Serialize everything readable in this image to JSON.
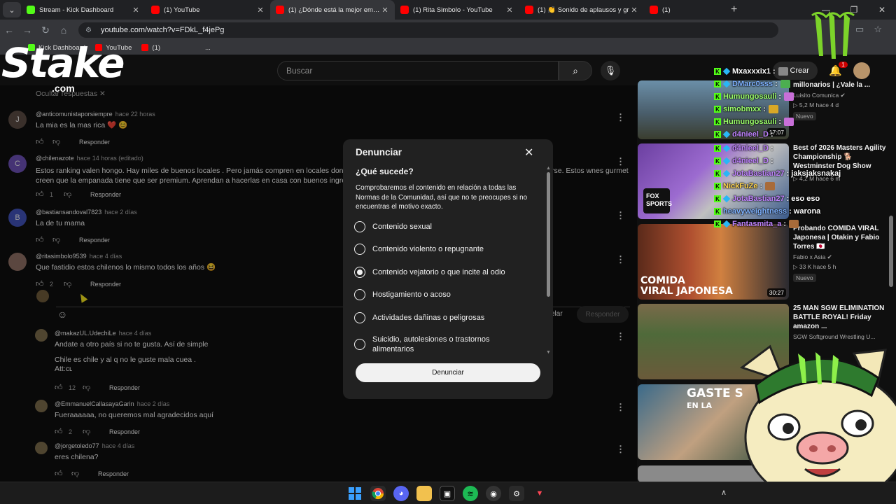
{
  "browser": {
    "tabs": [
      {
        "label": "Stream - Kick Dashboard",
        "icon": "kick-icon",
        "active": false
      },
      {
        "label": "(1) YouTube",
        "icon": "youtube-icon",
        "active": false
      },
      {
        "label": "(1) ¿Dónde está la mejor empan",
        "icon": "youtube-icon",
        "active": true
      },
      {
        "label": "(1) Rita Simbolo - YouTube",
        "icon": "youtube-icon",
        "active": false
      },
      {
        "label": "(1) 👏 Sonido de aplausos y gr",
        "icon": "youtube-icon",
        "active": false
      },
      {
        "label": "(1)",
        "icon": "youtube-icon",
        "active": false
      }
    ],
    "url": "youtube.com/watch?v=FDkL_f4jePg",
    "bookmarks": [
      "Kick Dashboard",
      "YouTube",
      "(1)",
      "..."
    ]
  },
  "header": {
    "search_placeholder": "Buscar",
    "create_label": "Crear",
    "notif_count": "1"
  },
  "overlay": {
    "stake_word": "Stake",
    "stake_com": ".com",
    "hide_replies": "Ocultar respuestas"
  },
  "comments": [
    {
      "author": "@anticomunistaporsiempre",
      "time": "hace 22 horas",
      "text": "La mia es la mas rica ❤️ 😊",
      "likes": "",
      "reply": "Responder",
      "avatar": "J",
      "avatar_color": "#5a4a42"
    },
    {
      "author": "@chilenazote",
      "time": "hace 14 horas (editado)",
      "text1": "Estos ranking valen hongo. Hay miles de buenos locales . Pero jamás compren en locales dond",
      "text1b": "rse. Estos wnes gurmet",
      "text2": "creen que la empanada tiene que ser premium. Aprendan a hacerlas en  casa con buenos ingre",
      "likes": "1",
      "reply": "Responder",
      "avatar": "C",
      "avatar_color": "#6a4fb3"
    },
    {
      "author": "@bastiansandoval7823",
      "time": "hace 2 días",
      "text": "La de tu mama",
      "likes": "",
      "reply": "Responder",
      "avatar": "B",
      "avatar_color": "#3f51b5"
    },
    {
      "author": "@ritasimbolo9539",
      "time": "hace 4 días",
      "text": "Que fastidio estos chilenos lo mismo todos los años 😆",
      "likes": "2",
      "reply": "Responder",
      "avatar": "",
      "avatar_color": "#8d6e63"
    }
  ],
  "reply_box": {
    "cancel": "elar",
    "submit": "Responder"
  },
  "replies": [
    {
      "author": "@makazUL.UdechiLe",
      "time": "hace 4 días",
      "line1": "Andate a otro país si no te gusta. Así de simple",
      "line2": "Chile es chile y al q no le guste mala cuea .",
      "line3": "Att:cʟ",
      "likes": "12",
      "reply": "Responder"
    },
    {
      "author": "@EmmanuelCallasayaGarin",
      "time": "hace 2 días",
      "line1": "Fueraaaaaa, no queremos mal agradecidos aquí",
      "likes": "2",
      "reply": "Responder"
    },
    {
      "author": "@jorgetoledo77",
      "time": "hace 4 días",
      "line1": "eres chilena?",
      "likes": "",
      "reply": "Responder"
    }
  ],
  "modal": {
    "title": "Denunciar",
    "question": "¿Qué sucede?",
    "description": "Comprobaremos el contenido en relación a todas las Normas de la Comunidad, así que no te preocupes si no encuentras el motivo exacto.",
    "options": [
      {
        "label": "Contenido sexual",
        "selected": false
      },
      {
        "label": "Contenido violento o repugnante",
        "selected": false
      },
      {
        "label": "Contenido vejatorio o que incite al odio",
        "selected": true
      },
      {
        "label": "Hostigamiento o acoso",
        "selected": false
      },
      {
        "label": "Actividades dañinas o peligrosas",
        "selected": false
      },
      {
        "label": "Suicidio, autolesiones o trastornos alimentarios",
        "selected": false
      }
    ],
    "submit": "Denunciar"
  },
  "sidebar_videos": [
    {
      "title": "millonarios | ¿Vale la ...",
      "channel": "Luisito Comunica ✔",
      "meta": "▷ 5,2 M   hace 4 d",
      "badge": "Nuevo",
      "duration": "17:07"
    },
    {
      "title": "Best of 2026 Masters Agility Championship 🐕 Westminster Dog Show",
      "channel": "",
      "meta": "▷ 4,2 M   hace 6 m",
      "badge": "",
      "duration": "",
      "thumb_text": "FOX SPORTS"
    },
    {
      "title": "Probando COMIDA VIRAL Japonesa | Otakin y Fabio Torres 🇯🇵",
      "channel": "Fabio x Asia ✔",
      "meta": "▷ 33 K   hace 5 h",
      "badge": "Nuevo",
      "duration": "30:27",
      "thumb_text1": "COMIDA",
      "thumb_text2": "VIRAL JAPONESA"
    },
    {
      "title": "25 MAN SGW ELIMINATION BATTLE ROYAL! Friday amazon ...",
      "channel": "SGW Softground Wrestling U...",
      "meta": "",
      "badge": "",
      "duration": ""
    },
    {
      "title": "",
      "channel": "",
      "meta": "",
      "badge": "",
      "duration": "",
      "thumb_text1": "GASTE S",
      "thumb_text2": "EN LA"
    }
  ],
  "chat": [
    {
      "user": "Mxaxxxix1",
      "msg": "",
      "color": "#ffffff",
      "gem": true
    },
    {
      "user": "DMarc0sss",
      "msg": "",
      "color": "#7fb2ff",
      "gem": true
    },
    {
      "user": "Humungosauli",
      "msg": "",
      "color": "#9cff6a",
      "gem": false
    },
    {
      "user": "simobmxx",
      "msg": "",
      "color": "#9cff6a",
      "gem": false
    },
    {
      "user": "Humungosauli",
      "msg": "",
      "color": "#9cff6a",
      "gem": false
    },
    {
      "user": "d4nieel_D",
      "msg": "",
      "color": "#c084ff",
      "gem": true
    },
    {
      "user": "d4nieel_D",
      "msg": "",
      "color": "#c084ff",
      "gem": true
    },
    {
      "user": "d4nieel_D",
      "msg": "",
      "color": "#c084ff",
      "gem": true
    },
    {
      "user": "JotaBastian27",
      "msg": "jaksjaksnakaj",
      "color": "#c084ff",
      "gem": true
    },
    {
      "user": "NickFuZe",
      "msg": "",
      "color": "#ffd54f",
      "gem": false
    },
    {
      "user": "JotaBastian27",
      "msg": "eso eso",
      "color": "#c084ff",
      "gem": true
    },
    {
      "user": "heavyweightness",
      "msg": "warona",
      "color": "#7fb2ff",
      "gem": false
    },
    {
      "user": "Fantasmita_a",
      "msg": "",
      "color": "#c084ff",
      "gem": true
    }
  ],
  "taskbar": {
    "icons": [
      "windows-icon",
      "chrome-icon",
      "discord-icon",
      "folder-icon",
      "capcut-icon",
      "spotify-icon",
      "obs-icon",
      "settings-icon",
      "valorant-icon"
    ]
  }
}
